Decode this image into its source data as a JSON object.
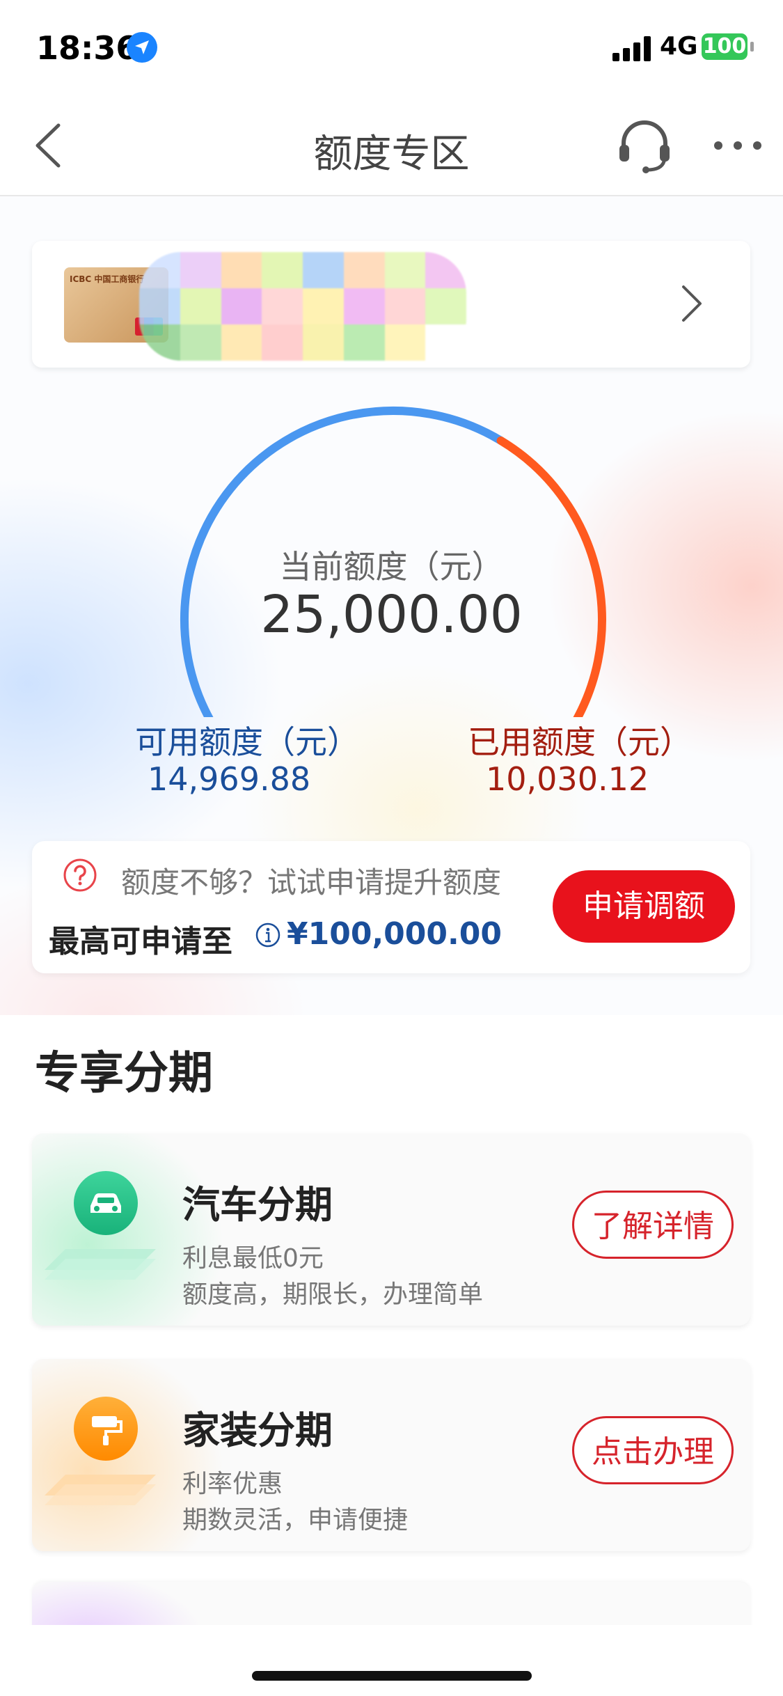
{
  "status_bar": {
    "time": "18:36",
    "network": "4G",
    "battery": "100",
    "icons": [
      "location-arrow-icon",
      "signal-bars-icon",
      "battery-icon"
    ]
  },
  "nav": {
    "title": "额度专区",
    "icons": [
      "back-chevron-icon",
      "customer-service-headset-icon",
      "more-dots-icon"
    ]
  },
  "card_selector": {
    "card_name": "",
    "card_brand": "ICBC 中国工商银行",
    "masked": true,
    "icon": "chevron-right-icon"
  },
  "credit": {
    "current_label": "当前额度（元）",
    "current_value": "25,000.00",
    "available_label": "可用额度（元）",
    "available_value": "14,969.88",
    "used_label": "已用额度（元）",
    "used_value": "10,030.12",
    "available_fraction": 0.5988,
    "used_fraction": 0.4012,
    "colors": {
      "available": "#4a97f0",
      "used": "#ff5a1f"
    }
  },
  "raise": {
    "tip": "额度不够？试试申请提升额度",
    "max_label": "最高可申请至",
    "max_value": "¥100,000.00",
    "apply_button": "申请调额",
    "icons": [
      "question-circle-icon",
      "info-circle-icon"
    ]
  },
  "installments": {
    "title": "专享分期",
    "items": [
      {
        "name": "汽车分期",
        "line1": "利息最低0元",
        "line2": "额度高，期限长，办理简单",
        "button": "了解详情",
        "icon": "car-icon"
      },
      {
        "name": "家装分期",
        "line1": "利率优惠",
        "line2": "期数灵活，申请便捷",
        "button": "点击办理",
        "icon": "paint-roller-icon"
      }
    ]
  }
}
